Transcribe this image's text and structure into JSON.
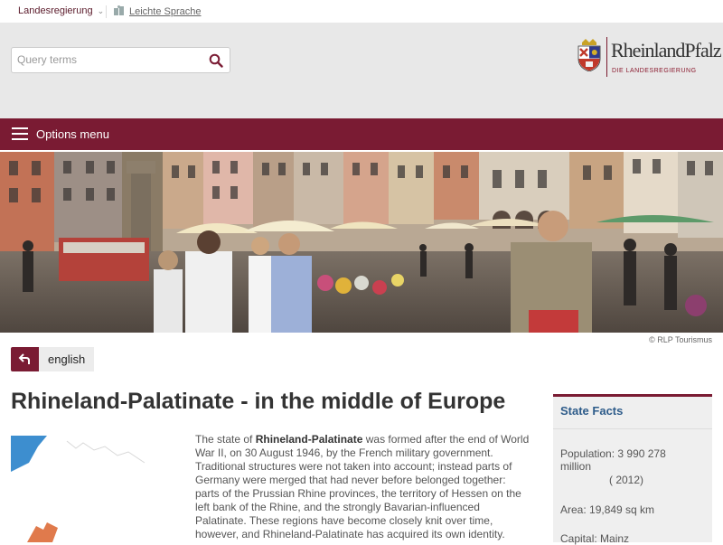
{
  "topbar": {
    "government_link": "Landesregierung",
    "easy_language_link": "Leichte Sprache"
  },
  "search": {
    "placeholder": "Query terms"
  },
  "logo": {
    "name": "RheinlandPfalz",
    "subtitle": "DIE LANDESREGIERUNG"
  },
  "nav": {
    "options_menu": "Options menu"
  },
  "hero": {
    "credit": "© RLP Tourismus"
  },
  "language": {
    "label": "english"
  },
  "article": {
    "title": "Rhineland-Palatinate - in the middle of Europe",
    "intro_lead": "The state of ",
    "intro_bold": "Rhineland-Palatinate",
    "intro_rest": " was formed after the end of World War II, on 30 August 1946, by the French military government. Traditional structures were not taken into account; instead parts of Germany were merged that had never before belonged together: parts of the Prussian Rhine provinces, the territory of Hessen on the left bank of the Rhine, and the strongly Bavarian-influenced Palatinate. These regions have become closely knit over time, however, and Rhineland-Palatinate has acquired its own identity."
  },
  "state_facts": {
    "heading": "State Facts",
    "population": "Population: 3 990 278 million",
    "population_year": "( 2012)",
    "area": "Area: 19,849 sq km",
    "capital": "Capital: Mainz"
  },
  "colors": {
    "brand": "#7a1b33",
    "facts_heading": "#2e5c8a",
    "map_sea": "#3d8ecf"
  }
}
